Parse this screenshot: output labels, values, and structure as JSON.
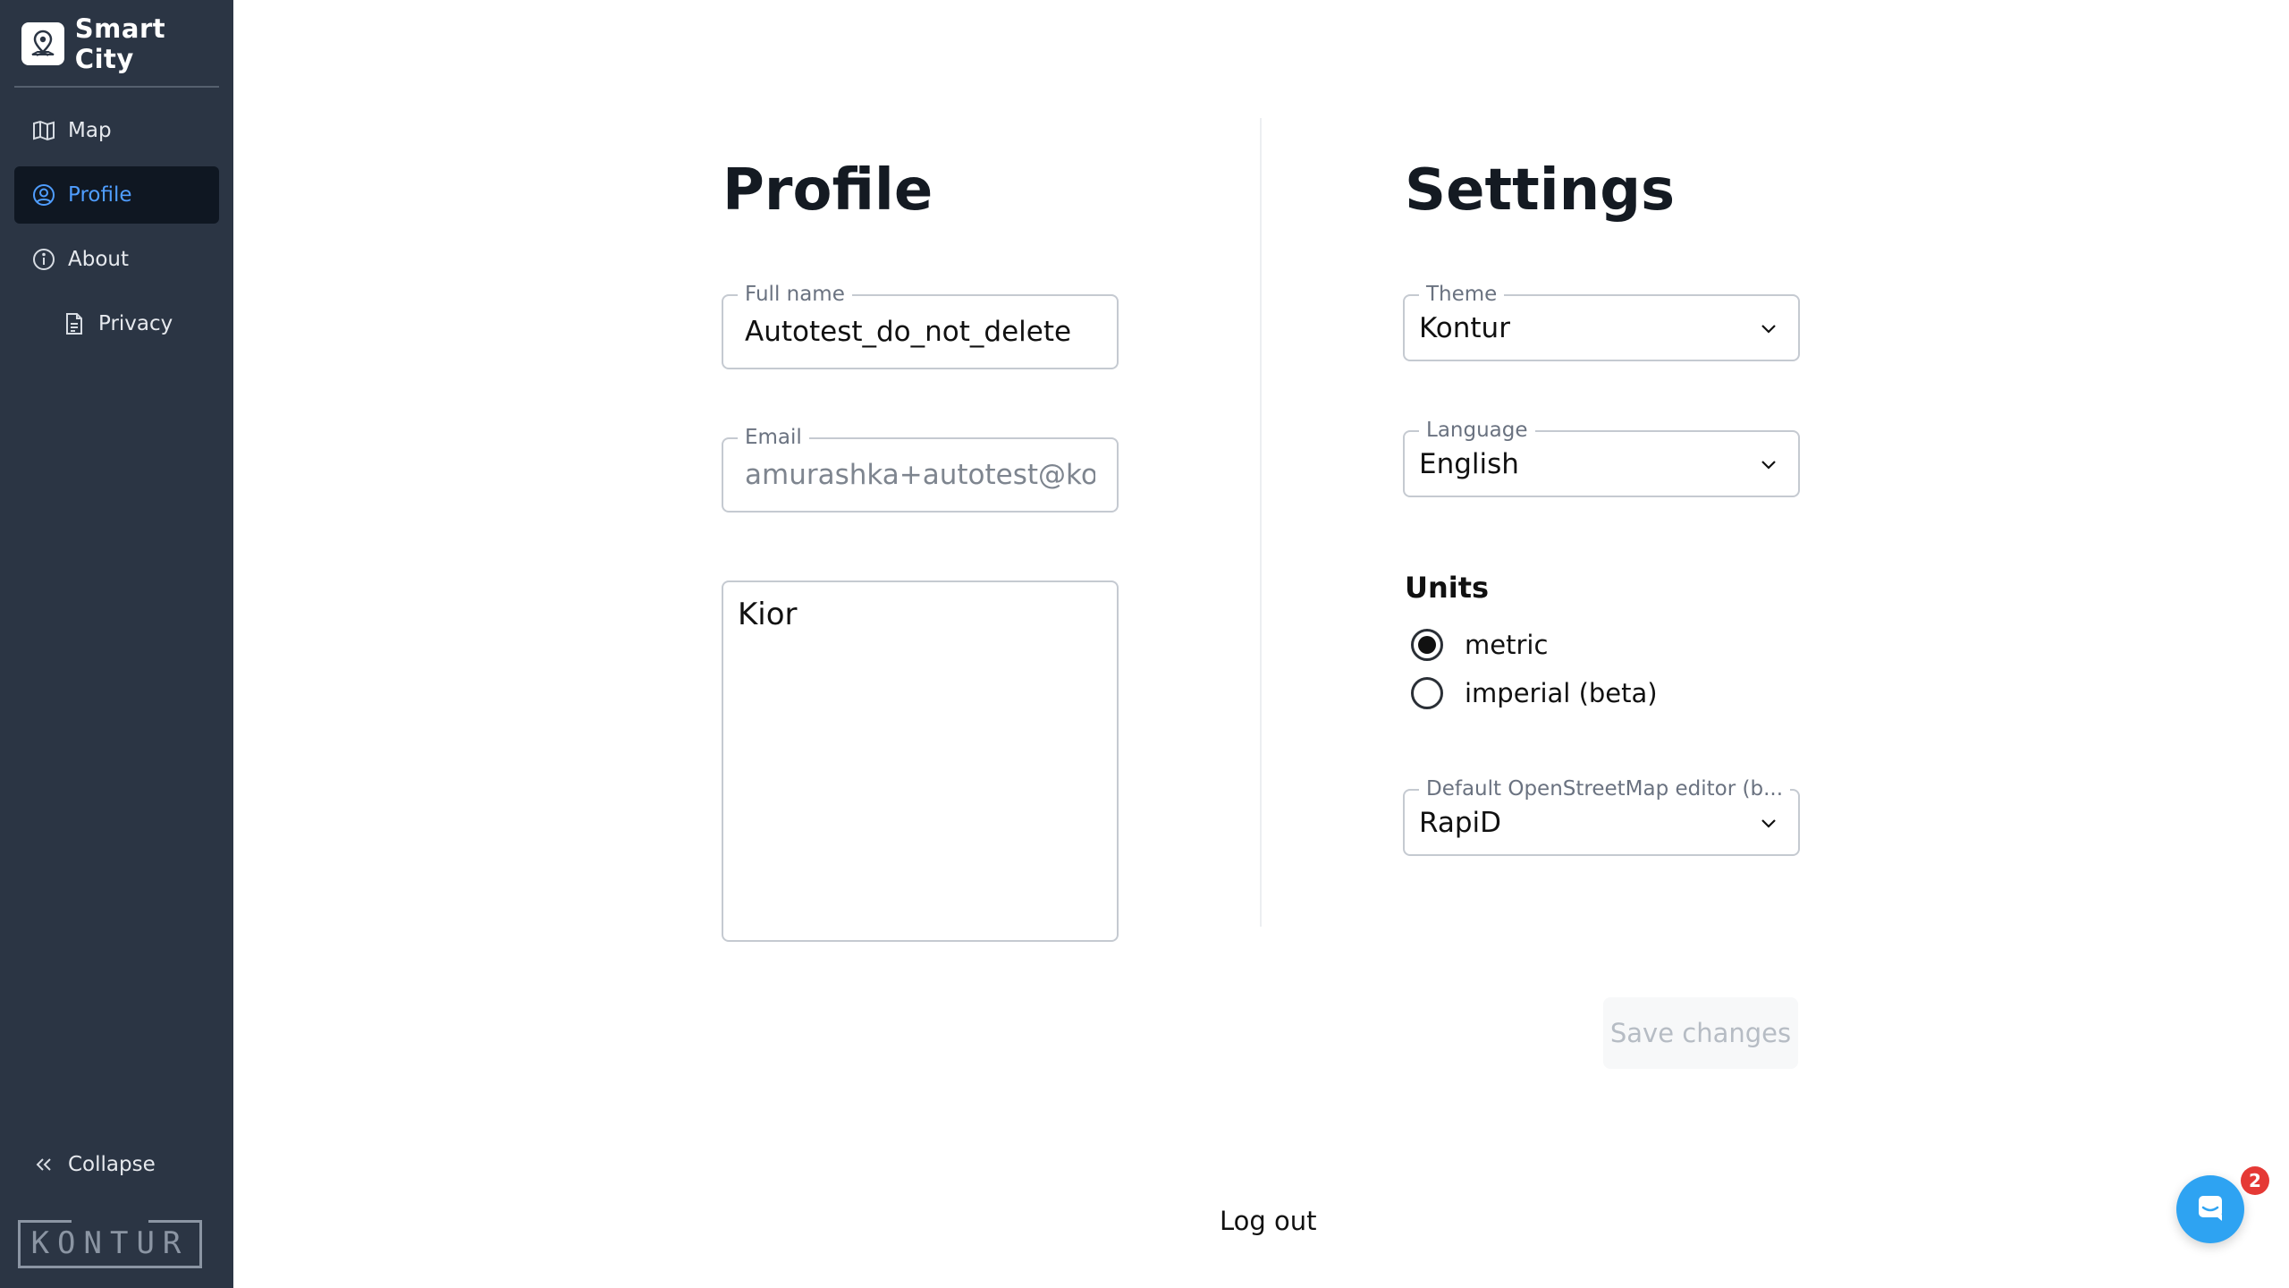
{
  "app": {
    "title": "Smart City",
    "logo_text": "KONTUR"
  },
  "sidebar": {
    "items": [
      {
        "label": "Map",
        "icon": "map-icon",
        "active": false
      },
      {
        "label": "Profile",
        "icon": "user-circle-icon",
        "active": true
      },
      {
        "label": "About",
        "icon": "info-icon",
        "active": false
      },
      {
        "label": "Privacy",
        "icon": "document-icon",
        "active": false
      }
    ],
    "collapse_label": "Collapse"
  },
  "profile": {
    "title": "Profile",
    "full_name": {
      "label": "Full name",
      "value": "Autotest_do_not_delete"
    },
    "email": {
      "label": "Email",
      "value": "amurashka+autotest@kont"
    },
    "bio": {
      "value": "Kior"
    }
  },
  "settings": {
    "title": "Settings",
    "theme": {
      "label": "Theme",
      "value": "Kontur"
    },
    "language": {
      "label": "Language",
      "value": "English"
    },
    "units": {
      "title": "Units",
      "options": [
        {
          "label": "metric",
          "selected": true
        },
        {
          "label": "imperial (beta)",
          "selected": false
        }
      ]
    },
    "osm_editor": {
      "label": "Default OpenStreetMap editor (b...",
      "value": "RapiD"
    }
  },
  "actions": {
    "save_label": "Save changes",
    "logout_label": "Log out"
  },
  "chat": {
    "badge_count": "2"
  },
  "colors": {
    "sidebar_bg": "#2b3544",
    "active_bg": "#0f1722",
    "active_text": "#4f9dff",
    "chat_blue": "#2ea3f2",
    "badge_red": "#e53935"
  }
}
